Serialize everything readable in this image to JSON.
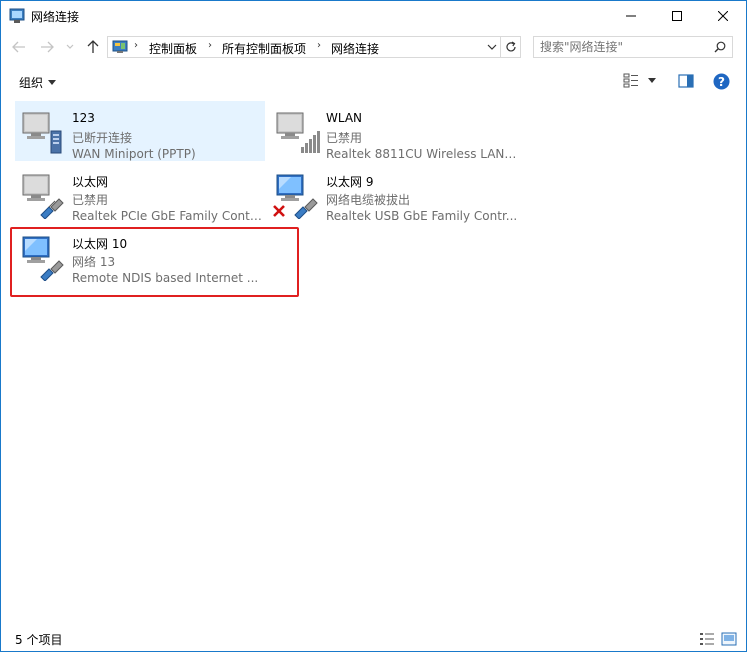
{
  "window": {
    "title": "网络连接"
  },
  "address": {
    "crumbs": [
      "控制面板",
      "所有控制面板项",
      "网络连接"
    ]
  },
  "search": {
    "placeholder": "搜索\"网络连接\""
  },
  "command_bar": {
    "organize_label": "组织"
  },
  "connections": [
    {
      "name": "123",
      "status": "已断开连接",
      "device": "WAN Miniport (PPTP)",
      "kind": "vpn",
      "selected": true
    },
    {
      "name": "WLAN",
      "status": "已禁用",
      "device": "Realtek 8811CU Wireless LAN ...",
      "kind": "wlan",
      "selected": false
    },
    {
      "name": "以太网",
      "status": "已禁用",
      "device": "Realtek PCIe GbE Family Contr...",
      "kind": "ethernet",
      "selected": false
    },
    {
      "name": "以太网 9",
      "status": "网络电缆被拔出",
      "device": "Realtek USB GbE Family Contr...",
      "kind": "ethernet-unplugged",
      "selected": false
    },
    {
      "name": "以太网 10",
      "status": "网络 13",
      "device": "Remote NDIS based Internet ...",
      "kind": "ethernet-active",
      "selected": false
    }
  ],
  "status_bar": {
    "item_count": "5 个项目"
  },
  "colors": {
    "accent": "#1979ca",
    "selection": "#e5f3ff",
    "highlight": "#e02020",
    "secondary_text": "#6d6d6d"
  }
}
